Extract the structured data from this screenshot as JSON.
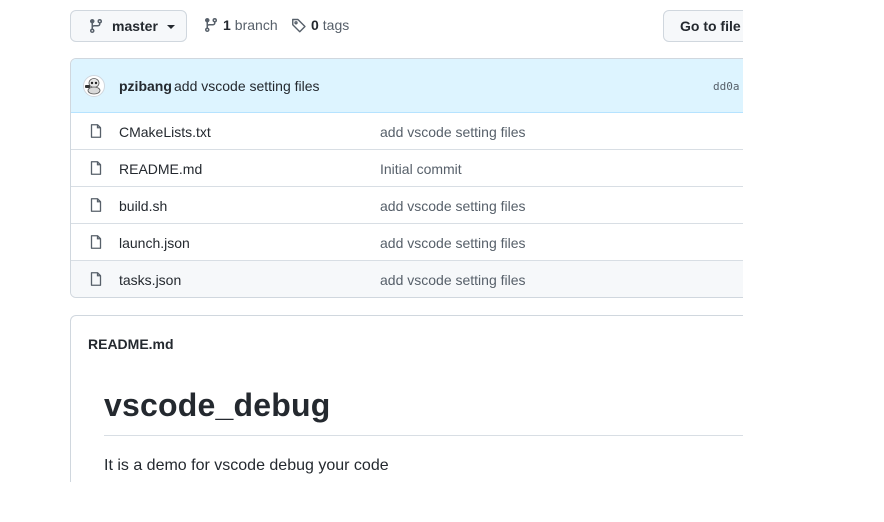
{
  "toolbar": {
    "branch_name": "master",
    "branch_count": "1",
    "branch_word": "branch",
    "tag_count": "0",
    "tag_word": "tags",
    "goto_file_label": "Go to file"
  },
  "latest_commit": {
    "author": "pzibang",
    "message": "add vscode setting files",
    "sha": "dd0a"
  },
  "files": [
    {
      "name": "CMakeLists.txt",
      "commit": "add vscode setting files",
      "icon": "file-icon"
    },
    {
      "name": "README.md",
      "commit": "Initial commit",
      "icon": "file-icon"
    },
    {
      "name": "build.sh",
      "commit": "add vscode setting files",
      "icon": "file-icon"
    },
    {
      "name": "launch.json",
      "commit": "add vscode setting files",
      "icon": "file-icon"
    },
    {
      "name": "tasks.json",
      "commit": "add vscode setting files",
      "icon": "file-icon"
    }
  ],
  "readme": {
    "header": "README.md",
    "title": "vscode_debug",
    "body": "It is a demo for vscode debug your code"
  },
  "colors": {
    "commit_bar_bg": "#ddf4ff",
    "border": "#d0d7de",
    "muted_text": "#57606a"
  }
}
